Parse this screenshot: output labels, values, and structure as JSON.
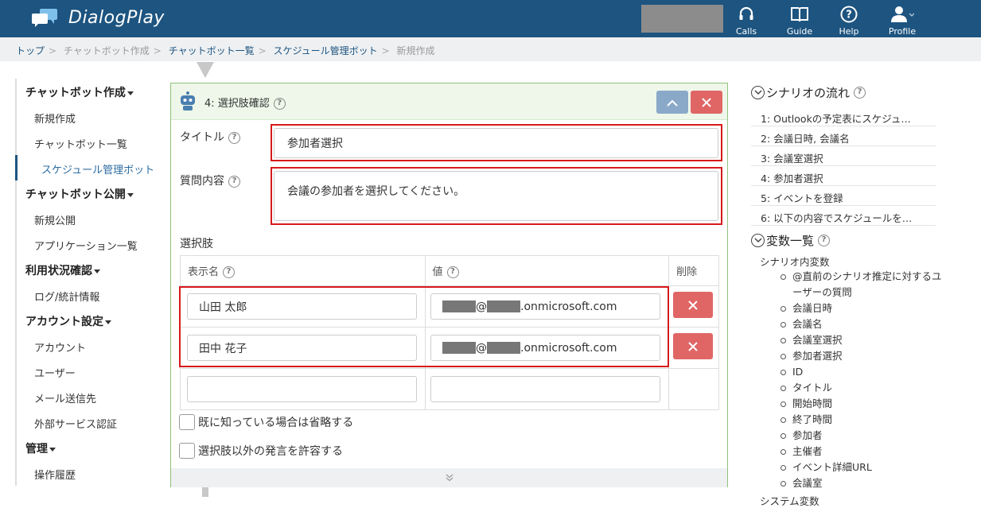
{
  "header": {
    "app_name": "DialogPlay",
    "nav": [
      {
        "label": "Calls",
        "icon": "headset-icon"
      },
      {
        "label": "Guide",
        "icon": "book-icon"
      },
      {
        "label": "Help",
        "icon": "help-icon"
      },
      {
        "label": "Profile",
        "icon": "user-icon"
      }
    ]
  },
  "breadcrumb": [
    "トップ",
    "チャットボット作成",
    "チャットボット一覧",
    "スケジュール管理ボット",
    "新規作成"
  ],
  "sidebar": {
    "groups": [
      {
        "title": "チャットボット作成",
        "items": [
          "新規作成",
          "チャットボット一覧",
          "スケジュール管理ボット"
        ]
      },
      {
        "title": "チャットボット公開",
        "items": [
          "新規公開",
          "アプリケーション一覧"
        ]
      },
      {
        "title": "利用状況確認",
        "items": [
          "ログ/統計情報"
        ]
      },
      {
        "title": "アカウント設定",
        "items": [
          "アカウント",
          "ユーザー",
          "メール送信先",
          "外部サービス認証"
        ]
      },
      {
        "title": "管理",
        "items": [
          "操作履歴"
        ]
      }
    ]
  },
  "panel": {
    "title": "4: 選択肢確認",
    "title_label": "タイトル",
    "title_value": "参加者選択",
    "question_label": "質問内容",
    "question_value": "会議の参加者を選択してください。",
    "options_label": "選択肢",
    "col_display": "表示名",
    "col_value": "値",
    "col_delete": "削除",
    "rows": [
      {
        "display": "山田 太郎",
        "value_suffix": ".onmicrosoft.com",
        "at": "@"
      },
      {
        "display": "田中 花子",
        "value_suffix": ".onmicrosoft.com",
        "at": "@"
      }
    ],
    "checkbox_skip": "既に知っている場合は省略する",
    "checkbox_allow": "選択肢以外の発言を許容する"
  },
  "scenario": {
    "title": "シナリオの流れ",
    "steps": [
      "1: Outlookの予定表にスケジュ…",
      "2: 会議日時, 会議名",
      "3: 会議室選択",
      "4: 参加者選択",
      "5: イベントを登録",
      "6: 以下の内容でスケジュールを…"
    ]
  },
  "variables": {
    "title": "変数一覧",
    "group": "シナリオ内変数",
    "items": [
      "@直前のシナリオ推定に対するユーザーの質問",
      "会議日時",
      "会議名",
      "会議室選択",
      "参加者選択",
      "ID",
      "タイトル",
      "開始時間",
      "終了時間",
      "参加者",
      "主催者",
      "イベント詳細URL",
      "会議室"
    ],
    "next_group": "システム変数"
  }
}
